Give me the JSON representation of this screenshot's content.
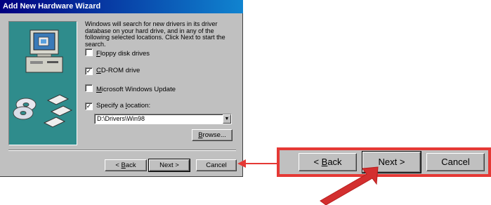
{
  "dialog": {
    "title": "Add New Hardware Wizard",
    "instructions": "Windows will search for new drivers in its driver database on your hard drive, and in any of the following selected locations. Click Next to start the search.",
    "options": [
      {
        "pre": "",
        "ul": "F",
        "post": "loppy disk drives",
        "checked": false
      },
      {
        "pre": "",
        "ul": "C",
        "post": "D-ROM drive",
        "checked": true
      },
      {
        "pre": "",
        "ul": "M",
        "post": "icrosoft Windows Update",
        "checked": false
      },
      {
        "pre": "Specify a ",
        "ul": "l",
        "post": "ocation:",
        "checked": true
      }
    ],
    "location_value": "D:\\Drivers\\Win98",
    "browse": {
      "pre": "",
      "ul": "B",
      "post": "rowse..."
    },
    "buttons": {
      "back": {
        "pre": "< ",
        "ul": "B",
        "post": "ack"
      },
      "next": "Next >",
      "cancel": "Cancel"
    }
  },
  "zoom_buttons": {
    "back": {
      "pre": "< ",
      "ul": "B",
      "post": "ack"
    },
    "next": "Next >",
    "cancel": "Cancel"
  },
  "colors": {
    "highlight": "#e53935",
    "title_start": "#000080",
    "title_end": "#1084d0",
    "face": "#c0c0c0"
  }
}
